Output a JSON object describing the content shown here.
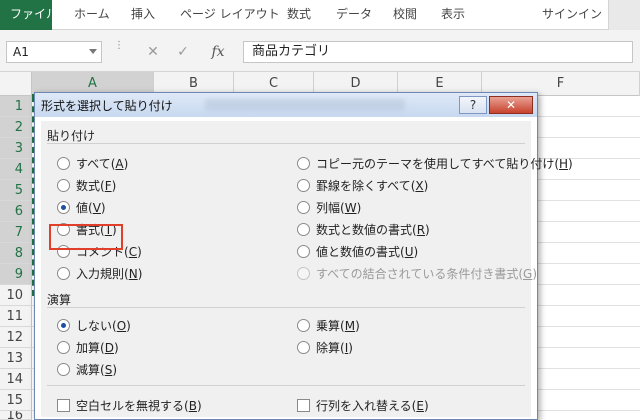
{
  "ribbon": {
    "tabs": [
      "ファイル",
      "ホーム",
      "挿入",
      "ページ レイアウト",
      "数式",
      "データ",
      "校閲",
      "表示"
    ],
    "signin": "サインイン"
  },
  "formula_bar": {
    "name_box": "A1",
    "fx": "fx",
    "cancel_icon": "✕",
    "enter_icon": "✓",
    "value": "商品カテゴリ"
  },
  "grid": {
    "columns": [
      "A",
      "B",
      "C",
      "D",
      "E",
      "F"
    ],
    "rows": [
      "1",
      "2",
      "3",
      "4",
      "5",
      "6",
      "7",
      "8",
      "9",
      "10",
      "11",
      "12",
      "13",
      "14",
      "15",
      "16"
    ]
  },
  "dialog": {
    "title": "形式を選択して貼り付け",
    "help_label": "?",
    "close_label": "✕",
    "paste_group": {
      "label": "貼り付け",
      "left_options": [
        {
          "text": "すべて",
          "key": "A",
          "checked": false
        },
        {
          "text": "数式",
          "key": "F",
          "checked": false
        },
        {
          "text": "値",
          "key": "V",
          "checked": true
        },
        {
          "text": "書式",
          "key": "T",
          "checked": false
        },
        {
          "text": "コメント",
          "key": "C",
          "checked": false
        },
        {
          "text": "入力規則",
          "key": "N",
          "checked": false
        }
      ],
      "right_options": [
        {
          "text": "コピー元のテーマを使用してすべて貼り付け",
          "key": "H",
          "disabled": false
        },
        {
          "text": "罫線を除くすべて",
          "key": "X",
          "disabled": false
        },
        {
          "text": "列幅",
          "key": "W",
          "disabled": false
        },
        {
          "text": "数式と数値の書式",
          "key": "R",
          "disabled": false
        },
        {
          "text": "値と数値の書式",
          "key": "U",
          "disabled": false
        },
        {
          "text": "すべての結合されている条件付き書式",
          "key": "G",
          "disabled": true
        }
      ]
    },
    "operation_group": {
      "label": "演算",
      "left_options": [
        {
          "text": "しない",
          "key": "O",
          "checked": true
        },
        {
          "text": "加算",
          "key": "D",
          "checked": false
        },
        {
          "text": "減算",
          "key": "S",
          "checked": false
        }
      ],
      "right_options": [
        {
          "text": "乗算",
          "key": "M",
          "checked": false
        },
        {
          "text": "除算",
          "key": "I",
          "checked": false
        }
      ]
    },
    "checkboxes": [
      {
        "text": "空白セルを無視する",
        "key": "B"
      },
      {
        "text": "行列を入れ替える",
        "key": "E"
      }
    ]
  },
  "colors": {
    "accent": "#217346",
    "highlight_box": "#e0402a",
    "radio_dot": "#1e4fa8"
  }
}
